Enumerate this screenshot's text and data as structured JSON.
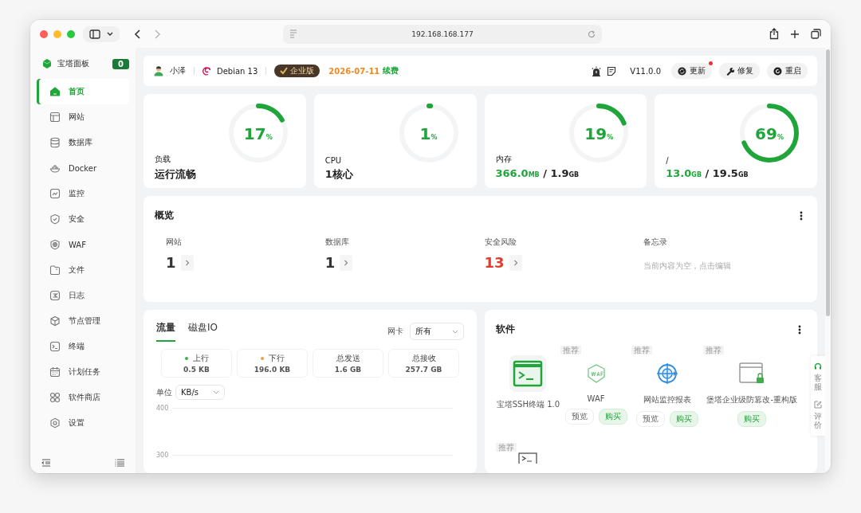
{
  "browser": {
    "url": "192.168.168.177"
  },
  "sidebar": {
    "brand": "宝塔面板",
    "badge": "0",
    "items": [
      {
        "label": "首页",
        "selected": true
      },
      {
        "label": "网站",
        "selected": false
      },
      {
        "label": "数据库",
        "selected": false
      },
      {
        "label": "Docker",
        "selected": false
      },
      {
        "label": "监控",
        "selected": false
      },
      {
        "label": "安全",
        "selected": false
      },
      {
        "label": "WAF",
        "selected": false
      },
      {
        "label": "文件",
        "selected": false
      },
      {
        "label": "日志",
        "selected": false
      },
      {
        "label": "节点管理",
        "selected": false
      },
      {
        "label": "终端",
        "selected": false
      },
      {
        "label": "计划任务",
        "selected": false
      },
      {
        "label": "软件商店",
        "selected": false
      },
      {
        "label": "设置",
        "selected": false
      }
    ]
  },
  "header": {
    "user": "小泽",
    "os": "Debian 13",
    "edition": "企业版",
    "expiry": "2026-07-11",
    "renew": "续费",
    "version": "V11.0.0",
    "buttons": [
      {
        "label": "更新",
        "dot": true
      },
      {
        "label": "修复",
        "dot": false
      },
      {
        "label": "重启",
        "dot": false
      }
    ]
  },
  "stats": [
    {
      "kind": "text",
      "label": "负载",
      "percent": "17",
      "unit": "%",
      "value": "运行流畅"
    },
    {
      "kind": "text",
      "label": "CPU",
      "percent": "1",
      "unit": "%",
      "value": "1核心"
    },
    {
      "kind": "usage",
      "label": "内存",
      "percent": "19",
      "unit": "%",
      "used": "366.0",
      "used_unit": "MB",
      "separator": "/",
      "total": "1.9",
      "total_unit": "GB"
    },
    {
      "kind": "usage",
      "label": "/",
      "percent": "69",
      "unit": "%",
      "used": "13.0",
      "used_unit": "GB",
      "separator": "/",
      "total": "19.5",
      "total_unit": "GB"
    }
  ],
  "overview": {
    "title": "概览",
    "items": [
      {
        "kind": "count",
        "label": "网站",
        "value": "1",
        "alert": false
      },
      {
        "kind": "count",
        "label": "数据库",
        "value": "1",
        "alert": false
      },
      {
        "kind": "count",
        "label": "安全风险",
        "value": "13",
        "alert": true
      },
      {
        "kind": "note",
        "label": "备忘录",
        "value": "当前内容为空，点击编辑"
      }
    ]
  },
  "traffic": {
    "tabs": [
      {
        "label": "流量",
        "selected": true
      },
      {
        "label": "磁盘IO",
        "selected": false
      }
    ],
    "nic_label": "网卡",
    "nic": "所有",
    "stats": [
      {
        "label": "上行",
        "value": "0.5 KB",
        "color": "#3eaf48"
      },
      {
        "label": "下行",
        "value": "196.0 KB",
        "color": "#f0a040"
      },
      {
        "label": "总发送",
        "value": "1.6 GB"
      },
      {
        "label": "总接收",
        "value": "257.7 GB"
      }
    ],
    "unit_label": "单位",
    "unit": "KB/s",
    "y_labels": [
      "400",
      "300"
    ]
  },
  "software": {
    "title": "软件",
    "items": [
      {
        "name": "宝塔SSH终端 1.0"
      },
      {
        "tag": "推荐",
        "name": "WAF",
        "buttons": [
          {
            "kind": "outline",
            "label": "预览"
          },
          {
            "kind": "buy",
            "label": "购买"
          }
        ]
      },
      {
        "tag": "推荐",
        "name": "网站监控报表",
        "buttons": [
          {
            "kind": "outline",
            "label": "预览"
          },
          {
            "kind": "buy",
            "label": "购买"
          }
        ]
      },
      {
        "tag": "推荐",
        "name": "堡塔企业级防篡改-重构版",
        "buttons": [
          {
            "kind": "buy",
            "label": "购买"
          }
        ]
      },
      {
        "tag": "推荐"
      }
    ]
  },
  "float_tabs": [
    {
      "label": "客服"
    },
    {
      "label": "评价"
    }
  ]
}
